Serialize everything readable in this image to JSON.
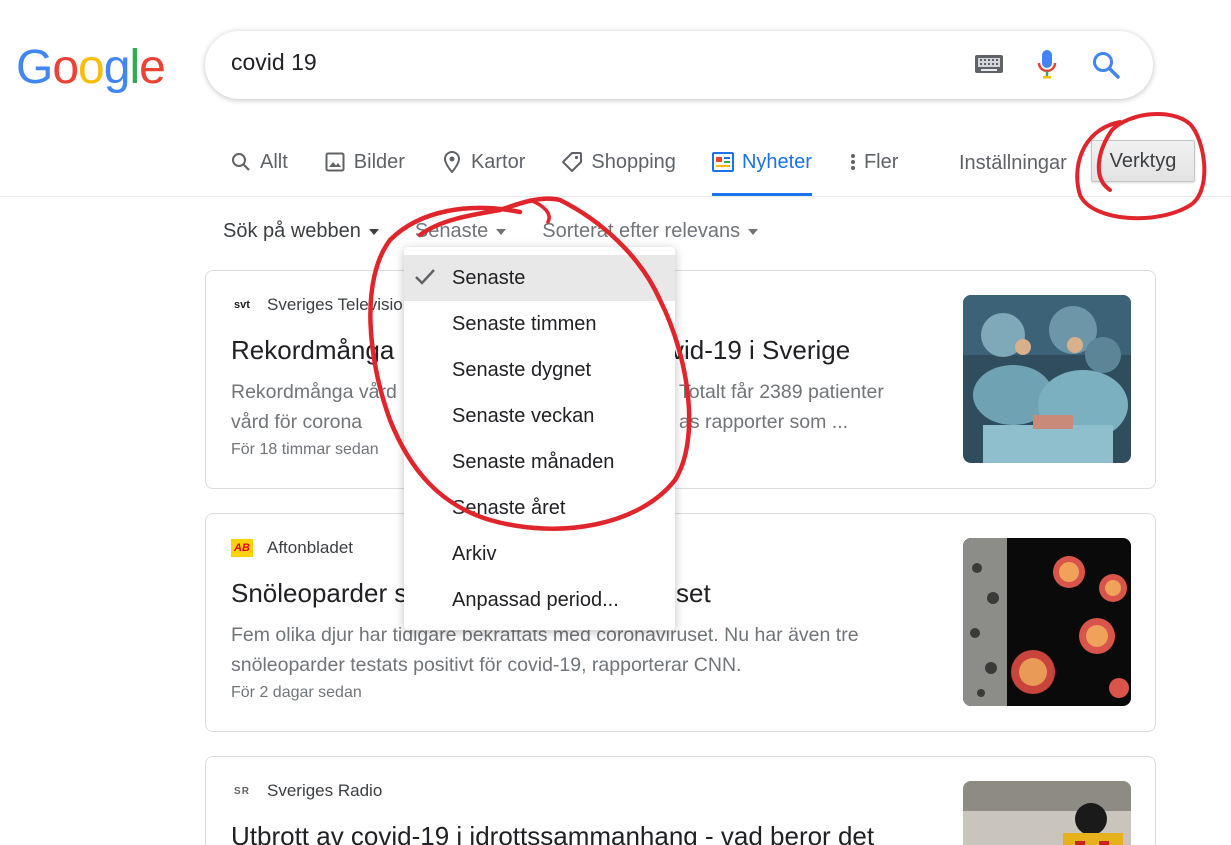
{
  "logo": {
    "text": "Google"
  },
  "search": {
    "query": "covid 19"
  },
  "tabs": [
    {
      "label": "Allt",
      "icon": "search-icon"
    },
    {
      "label": "Bilder",
      "icon": "image-icon"
    },
    {
      "label": "Kartor",
      "icon": "map-pin-icon"
    },
    {
      "label": "Shopping",
      "icon": "tag-icon"
    },
    {
      "label": "Nyheter",
      "icon": "news-icon",
      "active": true
    },
    {
      "label": "Fler",
      "icon": "more-vert-icon"
    }
  ],
  "settings_label": "Inställningar",
  "tools_label": "Verktyg",
  "toolbar": {
    "search_web": "Sök på webben",
    "recent": "Senaste",
    "sort": "Sorterat efter relevans"
  },
  "dropdown": {
    "items": [
      {
        "label": "Senaste",
        "selected": true
      },
      {
        "label": "Senaste timmen"
      },
      {
        "label": "Senaste dygnet"
      },
      {
        "label": "Senaste veckan"
      },
      {
        "label": "Senaste månaden"
      },
      {
        "label": "Senaste året"
      },
      {
        "label": "Arkiv"
      },
      {
        "label": "Anpassad period..."
      }
    ]
  },
  "results": [
    {
      "source": "Sveriges Televisio",
      "logo_text": "svt",
      "title_left": "Rekordmånga",
      "title_right": "vid-19 i Sverige",
      "snippet_line1_left": "Rekordmånga vård",
      "snippet_line1_right": "Totalt får 2389 patienter",
      "snippet_line2_left": "vård för corona",
      "snippet_line2_right": "as rapporter som ...",
      "time": "För 18 timmar sedan"
    },
    {
      "source": "Aftonbladet",
      "logo_text": "AB",
      "title_left": "Snöleoparder s",
      "title_right": "set",
      "snippet_line1": "Fem olika djur har tidigare bekräftats med coronaviruset. Nu har även tre",
      "snippet_line2": "snöleoparder testats positivt för covid-19, rapporterar CNN.",
      "time": "För 2 dagar sedan"
    },
    {
      "source": "Sveriges Radio",
      "logo_text": "SR",
      "title": "Utbrott av covid-19 i idrottssammanhang - vad beror det"
    }
  ],
  "colors": {
    "accent": "#1a73e8",
    "marker": "#e0262c"
  }
}
